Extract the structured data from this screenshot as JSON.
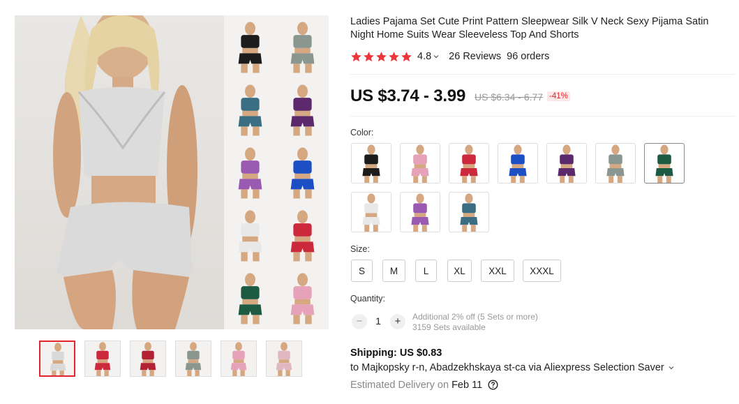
{
  "product": {
    "title": "Ladies Pajama Set Cute Print Pattern Sleepwear Silk V Neck Sexy Pijama Satin Night Home Suits Wear Sleeveless Top And Shorts",
    "rating": "4.8",
    "reviews": "26 Reviews",
    "orders": "96 orders",
    "star_color": "#f0343c"
  },
  "price": {
    "current": "US $3.74 - 3.99",
    "original": "US $6.34 - 6.77",
    "discount": "-41%"
  },
  "color": {
    "label": "Color:",
    "swatches": [
      {
        "name": "black",
        "hex": "#1c1c1c"
      },
      {
        "name": "pink",
        "hex": "#e6a2b8"
      },
      {
        "name": "red",
        "hex": "#cc2a3c"
      },
      {
        "name": "blue",
        "hex": "#1c4fc4"
      },
      {
        "name": "purple",
        "hex": "#5c2a6c"
      },
      {
        "name": "grey",
        "hex": "#8a9690"
      },
      {
        "name": "green",
        "hex": "#1d5a44"
      },
      {
        "name": "white",
        "hex": "#e8e8e8"
      },
      {
        "name": "violet",
        "hex": "#9a5ab2"
      },
      {
        "name": "teal",
        "hex": "#3b6e82"
      }
    ]
  },
  "size": {
    "label": "Size:",
    "options": [
      "S",
      "M",
      "L",
      "XL",
      "XXL",
      "XXXL"
    ]
  },
  "quantity": {
    "label": "Quantity:",
    "value": "1",
    "minus": "−",
    "plus": "+",
    "discount_note": "Additional 2% off (5 Sets or more)",
    "available": "3159 Sets available"
  },
  "shipping": {
    "label": "Shipping: US $0.83",
    "destination": "to Majkopsky r-n, Abadzekhskaya st-ca via Aliexpress Selection Saver",
    "delivery_label": "Estimated Delivery on",
    "delivery_date": "Feb 11"
  },
  "gallery": {
    "main_color": "#d9d9d9",
    "grid_colors": [
      "#1c1c1c",
      "#8a9690",
      "#3b6e82",
      "#5c2a6c",
      "#9a5ab2",
      "#1c4fc4",
      "#e8e8e8",
      "#cc2a3c",
      "#1d5a44",
      "#e6a2b8"
    ],
    "thumb_colors": [
      "#d9d9d9",
      "#cc2a3c",
      "#b22234",
      "#8a9690",
      "#e6a2b8",
      "#e0b8c4"
    ]
  }
}
